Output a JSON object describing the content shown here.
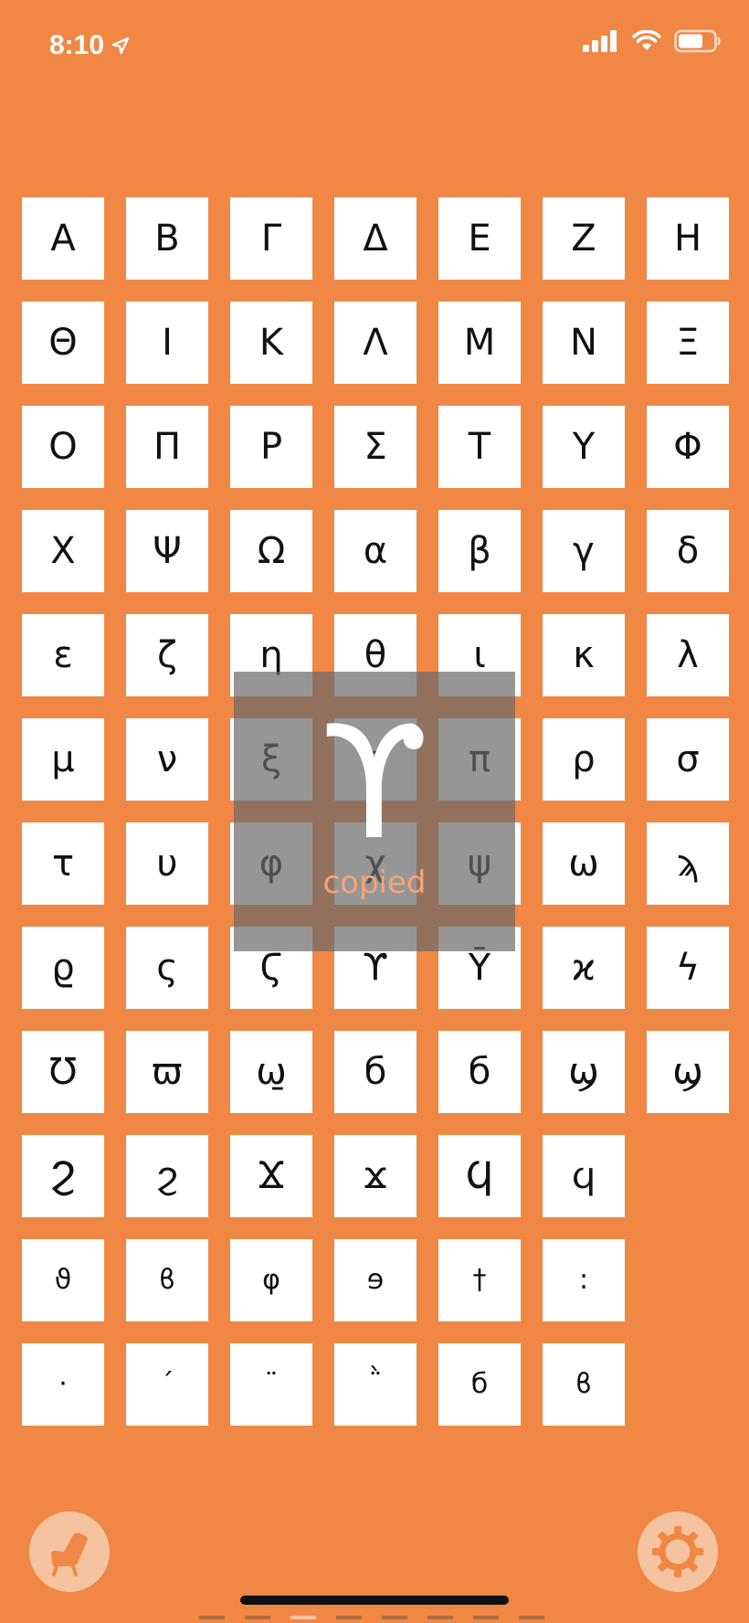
{
  "status_bar": {
    "time": "8:10",
    "icons": [
      "location-arrow-icon",
      "signal-icon",
      "wifi-icon",
      "battery-icon"
    ]
  },
  "grid": {
    "rows": [
      [
        "Α",
        "Β",
        "Γ",
        "Δ",
        "Ε",
        "Ζ",
        "Η"
      ],
      [
        "Θ",
        "Ι",
        "Κ",
        "Λ",
        "Μ",
        "Ν",
        "Ξ"
      ],
      [
        "Ο",
        "Π",
        "Ρ",
        "Σ",
        "Τ",
        "Υ",
        "Φ"
      ],
      [
        "Χ",
        "Ψ",
        "Ω",
        "α",
        "β",
        "γ",
        "δ"
      ],
      [
        "ε",
        "ζ",
        "η",
        "θ",
        "ι",
        "κ",
        "λ"
      ],
      [
        "μ",
        "ν",
        "ξ",
        "ο",
        "π",
        "ρ",
        "σ"
      ],
      [
        "τ",
        "υ",
        "φ",
        "χ",
        "ψ",
        "ω",
        "ϡ"
      ],
      [
        "ϱ",
        "ς",
        "Ϛ",
        "ϒ",
        "Ȳ",
        "ϰ",
        "ϟ"
      ],
      [
        "Ʊ",
        "ϖ",
        "ω̱",
        "б",
        "б",
        "ϣ",
        "ϣ"
      ],
      [
        "Ϩ",
        "ϩ",
        "Ϫ",
        "ϫ",
        "Ϥ",
        "ϥ"
      ],
      [
        "ϑ",
        "ϐ",
        "φ",
        "ɘ",
        "†",
        ":"
      ],
      [
        "·",
        "ˊ",
        "¨",
        "῭",
        "б",
        "ϐ"
      ]
    ]
  },
  "overlay": {
    "glyph": "ϒ",
    "label": "copied"
  },
  "bottom": {
    "left_icon": "chair-icon",
    "right_icon": "gear-icon",
    "pages": 8,
    "active_page": 2
  },
  "colors": {
    "background": "#f08744",
    "tile": "#ffffff",
    "button": "#f6c3a0",
    "overlay": "#696969"
  }
}
